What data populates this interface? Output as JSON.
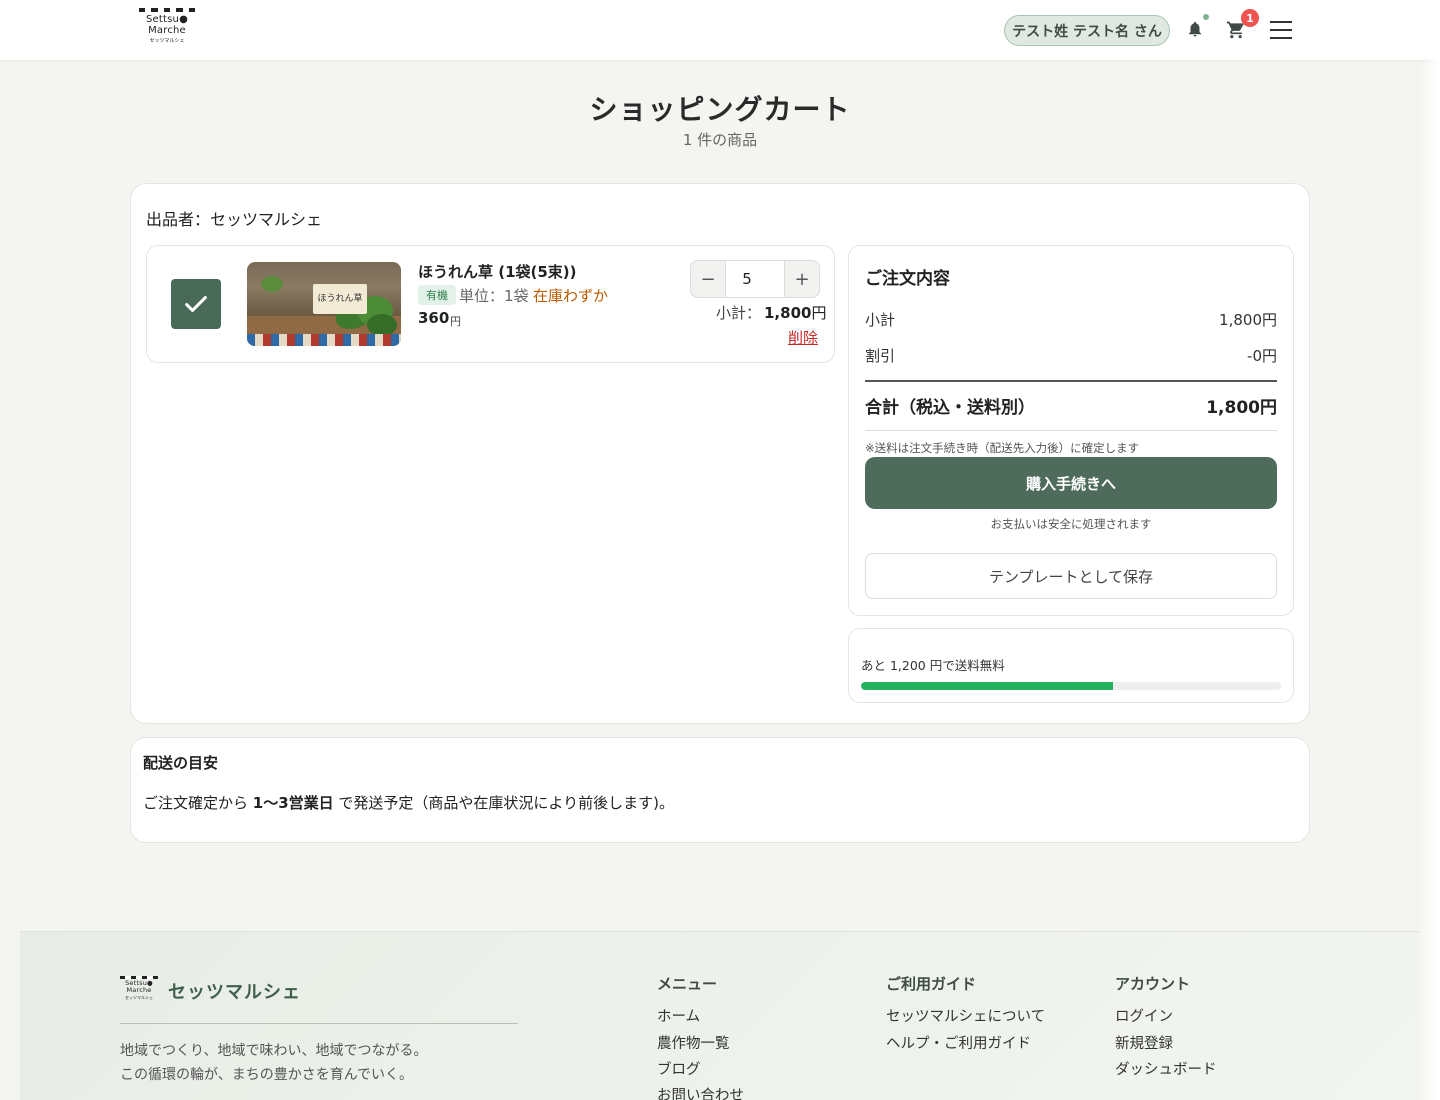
{
  "header": {
    "logo_line1": "Settsu●",
    "logo_line2": "Marche",
    "logo_sub": "セッツマルシェ",
    "user_label": "テスト姓 テスト名 さん",
    "cart_count": "1"
  },
  "page": {
    "title": "ショッピングカート",
    "subtitle": "1 件の商品"
  },
  "cart": {
    "seller": "出品者：セッツマルシェ",
    "item": {
      "name": "ほうれん草 (1袋(5束))",
      "organic_tag": "有機",
      "unit": "単位：1袋",
      "stock": "在庫わずか",
      "price": "360",
      "price_unit": "円",
      "thumb_sign": "ほうれん草",
      "qty_minus": "−",
      "quantity": "5",
      "qty_plus": "+",
      "subtotal_label": "小計：",
      "subtotal_value": "1,800",
      "subtotal_unit": "円",
      "delete_label": "削除"
    }
  },
  "summary": {
    "title": "ご注文内容",
    "subtotal_label": "小計",
    "subtotal_value": "1,800円",
    "discount_label": "割引",
    "discount_value": "-0円",
    "total_label": "合計（税込・送料別）",
    "total_value": "1,800円",
    "shipping_note": "※送料は注文手続き時（配送先入力後）に確定します",
    "checkout_label": "購入手続きへ",
    "secure_note": "お支払いは安全に処理されます",
    "template_label": "テンプレートとして保存"
  },
  "free_shipping": {
    "text": "あと 1,200 円で送料無料",
    "progress": 0.6
  },
  "delivery": {
    "title": "配送の目安",
    "text_before": "ご注文確定から ",
    "text_bold": "1〜3営業日",
    "text_after": " で発送予定（商品や在庫状況により前後します)。"
  },
  "footer": {
    "brand": "セッツマルシェ",
    "tagline_1": "地域でつくり、地域で味わい、地域でつながる。",
    "tagline_2": "この循環の輪が、まちの豊かさを育んでいく。",
    "menu": {
      "title": "メニュー",
      "links": [
        "ホーム",
        "農作物一覧",
        "ブログ",
        "お問い合わせ"
      ]
    },
    "guide": {
      "title": "ご利用ガイド",
      "links": [
        "セッツマルシェについて",
        "ヘルプ・ご利用ガイド"
      ]
    },
    "account": {
      "title": "アカウント",
      "links": [
        "ログイン",
        "新規登録",
        "ダッシュボード"
      ]
    }
  },
  "colors": {
    "primary": "#4f6b5c",
    "stock_warning": "#c05a00",
    "delete": "#c62828",
    "progress": "#22b35c",
    "badge": "#ef5350"
  }
}
